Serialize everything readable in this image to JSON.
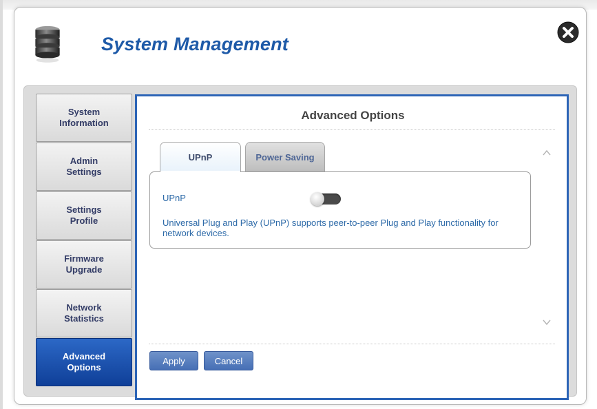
{
  "dialog": {
    "title": "System Management",
    "icon": "database-icon",
    "close_icon": "close-icon"
  },
  "sidebar": {
    "items": [
      {
        "line1": "System",
        "line2": "Information",
        "active": false
      },
      {
        "line1": "Admin",
        "line2": "Settings",
        "active": false
      },
      {
        "line1": "Settings",
        "line2": "Profile",
        "active": false
      },
      {
        "line1": "Firmware",
        "line2": "Upgrade",
        "active": false
      },
      {
        "line1": "Network",
        "line2": "Statistics",
        "active": false
      },
      {
        "line1": "Advanced",
        "line2": "Options",
        "active": true
      }
    ]
  },
  "content": {
    "title": "Advanced Options",
    "tabs": [
      {
        "label": "UPnP",
        "active": true
      },
      {
        "label": "Power Saving",
        "active": false
      }
    ],
    "upnp": {
      "label": "UPnP",
      "enabled": false,
      "description": "Universal Plug and Play (UPnP) supports peer-to-peer Plug and Play functionality for network devices."
    }
  },
  "buttons": {
    "apply": "Apply",
    "cancel": "Cancel"
  },
  "colors": {
    "accent": "#1e5aa8",
    "frame": "#2c64b6",
    "active_nav": "#1a4ea8",
    "text_blue": "#2d6aa8"
  }
}
